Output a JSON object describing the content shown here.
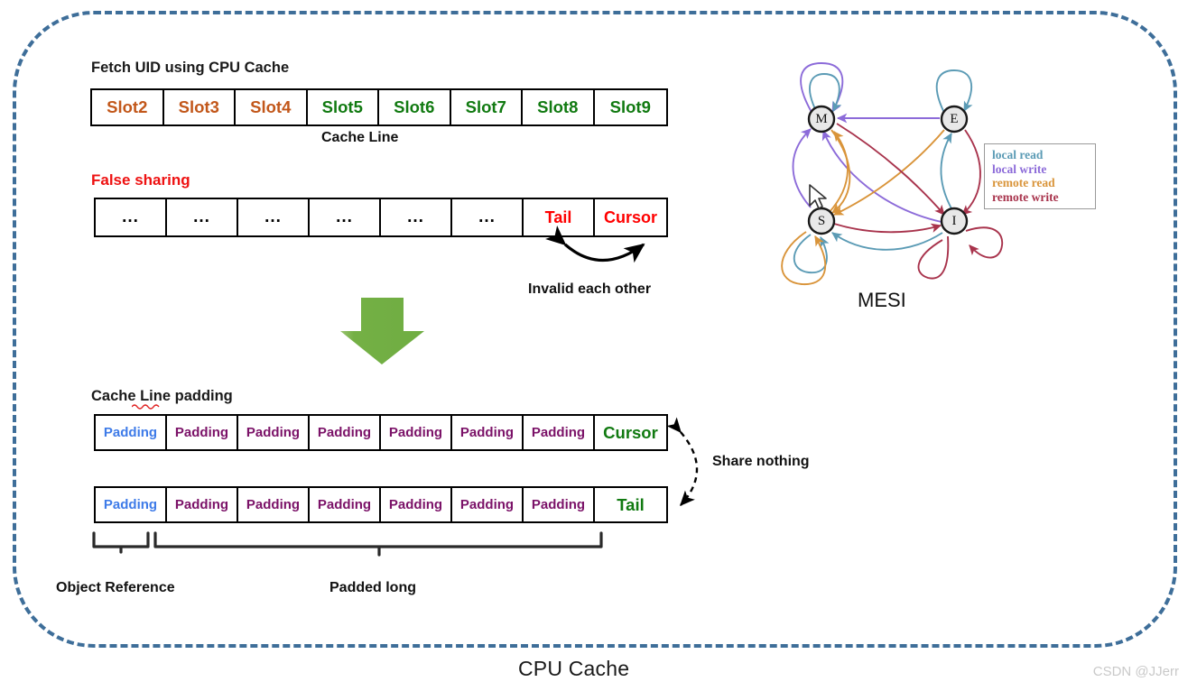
{
  "frame": {
    "title": "CPU Cache",
    "border_color": "#3E6E99",
    "watermark": "CSDN @JJerr"
  },
  "colors": {
    "orange": "#C2571A",
    "green": "#117A11",
    "red": "#FF0000",
    "blue": "#3E7BE8",
    "purple": "#7B1268",
    "arrow_green": "#72B043",
    "local_read": "#5B9BB5",
    "local_write": "#8C6BD9",
    "remote_read": "#D9943A",
    "remote_write": "#A8334C"
  },
  "fetch_section": {
    "label": "Fetch UID using CPU Cache",
    "caption": "Cache Line",
    "cells": [
      {
        "text": "Slot2",
        "color": "orange"
      },
      {
        "text": "Slot3",
        "color": "orange"
      },
      {
        "text": "Slot4",
        "color": "orange"
      },
      {
        "text": "Slot5",
        "color": "green"
      },
      {
        "text": "Slot6",
        "color": "green"
      },
      {
        "text": "Slot7",
        "color": "green"
      },
      {
        "text": "Slot8",
        "color": "green"
      },
      {
        "text": "Slot9",
        "color": "green"
      }
    ]
  },
  "false_sharing_section": {
    "label": "False sharing",
    "annotation": "Invalid each other",
    "cells": [
      {
        "text": "...",
        "color": "black"
      },
      {
        "text": "...",
        "color": "black"
      },
      {
        "text": "...",
        "color": "black"
      },
      {
        "text": "...",
        "color": "black"
      },
      {
        "text": "...",
        "color": "black"
      },
      {
        "text": "...",
        "color": "black"
      },
      {
        "text": "Tail",
        "color": "red"
      },
      {
        "text": "Cursor",
        "color": "red"
      }
    ]
  },
  "padding_section": {
    "label": "Cache Line padding",
    "annotation": "Share nothing",
    "row1": [
      {
        "text": "Padding",
        "color": "blue"
      },
      {
        "text": "Padding",
        "color": "purple"
      },
      {
        "text": "Padding",
        "color": "purple"
      },
      {
        "text": "Padding",
        "color": "purple"
      },
      {
        "text": "Padding",
        "color": "purple"
      },
      {
        "text": "Padding",
        "color": "purple"
      },
      {
        "text": "Padding",
        "color": "purple"
      },
      {
        "text": "Cursor",
        "color": "green"
      }
    ],
    "row2": [
      {
        "text": "Padding",
        "color": "blue"
      },
      {
        "text": "Padding",
        "color": "purple"
      },
      {
        "text": "Padding",
        "color": "purple"
      },
      {
        "text": "Padding",
        "color": "purple"
      },
      {
        "text": "Padding",
        "color": "purple"
      },
      {
        "text": "Padding",
        "color": "purple"
      },
      {
        "text": "Padding",
        "color": "purple"
      },
      {
        "text": "Tail",
        "color": "green"
      }
    ],
    "brace_left_label": "Object Reference",
    "brace_right_label": "Padded long"
  },
  "mesi": {
    "title": "MESI",
    "nodes": [
      {
        "id": "M",
        "label": "M"
      },
      {
        "id": "E",
        "label": "E"
      },
      {
        "id": "S",
        "label": "S"
      },
      {
        "id": "I",
        "label": "I"
      }
    ],
    "legend": [
      {
        "label": "local read",
        "color": "#5B9BB5"
      },
      {
        "label": "local write",
        "color": "#8C6BD9"
      },
      {
        "label": "remote read",
        "color": "#D9943A"
      },
      {
        "label": "remote write",
        "color": "#A8334C"
      }
    ]
  }
}
